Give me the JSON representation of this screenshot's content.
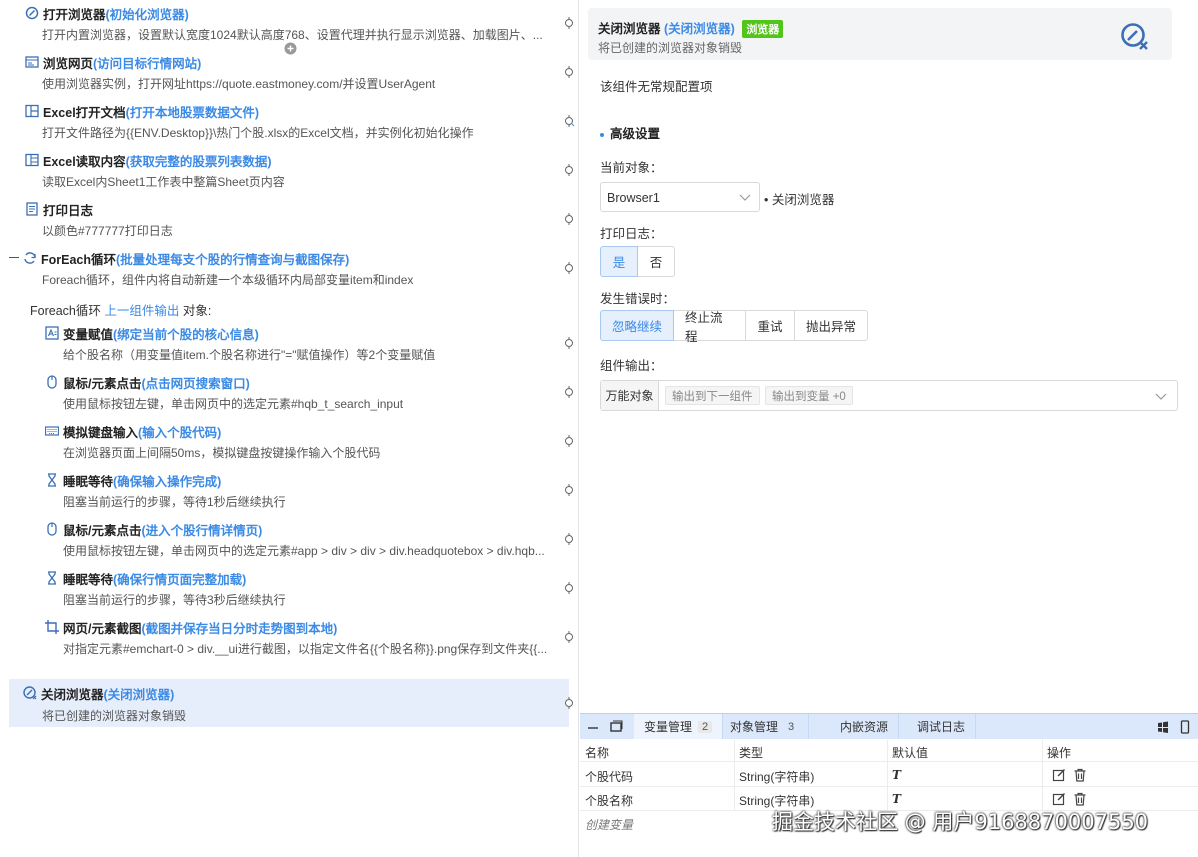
{
  "flow": {
    "steps": [
      {
        "title": "打开浏览器",
        "alias": "(初始化浏览器)",
        "desc": "打开内置浏览器，设置默认宽度1024默认高度768、设置代理并执行显示浏览器、加载图片、..."
      },
      {
        "title": "浏览网页",
        "alias": "(访问目标行情网站)",
        "desc": "使用浏览器实例，打开网址https://quote.eastmoney.com/并设置UserAgent"
      },
      {
        "title": "Excel打开文档",
        "alias": "(打开本地股票数据文件)",
        "desc": "打开文件路径为{{ENV.Desktop}}\\热门个股.xlsx的Excel文档，并实例化初始化操作"
      },
      {
        "title": "Excel读取内容",
        "alias": "(获取完整的股票列表数据)",
        "desc": "读取Excel内Sheet1工作表中整篇Sheet页内容"
      },
      {
        "title": "打印日志",
        "alias": "",
        "desc": "以颜色#777777打印日志"
      },
      {
        "title": "ForEach循环",
        "alias": " (批量处理每支个股的行情查询与截图保存)",
        "desc": "Foreach循环，组件内将自动新建一个本级循环内局部变量item和index"
      },
      {
        "title": "变量赋值",
        "alias": "(绑定当前个股的核心信息)",
        "desc": "给个股名称（用变量值item.个股名称进行\"=\"赋值操作）等2个变量赋值"
      },
      {
        "title": "鼠标/元素点击",
        "alias": "(点击网页搜索窗口)",
        "desc": "使用鼠标按钮左键，单击网页中的选定元素#hqb_t_search_input"
      },
      {
        "title": "模拟键盘输入",
        "alias": "(输入个股代码)",
        "desc": "在浏览器页面上间隔50ms，模拟键盘按键操作输入个股代码"
      },
      {
        "title": "睡眠等待",
        "alias": "(确保输入操作完成)",
        "desc": "阻塞当前运行的步骤，等待1秒后继续执行"
      },
      {
        "title": "鼠标/元素点击",
        "alias": "(进入个股行情详情页)",
        "desc": "使用鼠标按钮左键，单击网页中的选定元素#app > div > div > div.headquotebox > div.hqb..."
      },
      {
        "title": "睡眠等待",
        "alias": "(确保行情页面完整加载)",
        "desc": "阻塞当前运行的步骤，等待3秒后继续执行"
      },
      {
        "title": "网页/元素截图",
        "alias": "(截图并保存当日分时走势图到本地)",
        "desc": "对指定元素#emchart-0 > div.__ui进行截图，以指定文件名{{个股名称}}.png保存到文件夹{{..."
      },
      {
        "title": "关闭浏览器",
        "alias": "(关闭浏览器)",
        "desc": "将已创建的浏览器对象销毁"
      }
    ],
    "foreach_label": {
      "prefix": "Foreach循环 ",
      "link": "上一组件输出",
      "suffix": " 对象:"
    }
  },
  "config": {
    "header": {
      "title": "关闭浏览器",
      "alias": "(关闭浏览器)",
      "tag": "浏览器",
      "desc": "将已创建的浏览器对象销毁"
    },
    "no_config": "该组件无常规配置项",
    "advanced": "高级设置",
    "current_object_label": "当前对象：",
    "current_object_value": "Browser1",
    "current_object_note": "关闭浏览器",
    "print_log_label": "打印日志：",
    "print_log_options": [
      "是",
      "否"
    ],
    "on_error_label": "发生错误时：",
    "on_error_options": [
      "忽略继续",
      "终止流程",
      "重试",
      "抛出异常"
    ],
    "output_label": "组件输出：",
    "output_kind": "万能对象",
    "output_chips": [
      "输出到下一组件",
      "输出到变量 +0"
    ]
  },
  "bottom": {
    "tabs": [
      {
        "label": "变量管理",
        "count": "2"
      },
      {
        "label": "对象管理",
        "count": "3"
      },
      {
        "label": "内嵌资源",
        "count": ""
      },
      {
        "label": "调试日志",
        "count": ""
      }
    ],
    "columns": [
      "名称",
      "类型",
      "默认值",
      "操作"
    ],
    "rows": [
      {
        "name": "个股代码",
        "type": "String(字符串)",
        "default": "T"
      },
      {
        "name": "个股名称",
        "type": "String(字符串)",
        "default": "T"
      }
    ],
    "create": "创建变量"
  },
  "watermark": "掘金技术社区 @ 用户9168870007550",
  "colors": {
    "accent": "#3b8ae6",
    "tag_green": "#52c41a",
    "selected_bg": "#e7eefb",
    "tabbar_bg": "#dbe8fb"
  }
}
